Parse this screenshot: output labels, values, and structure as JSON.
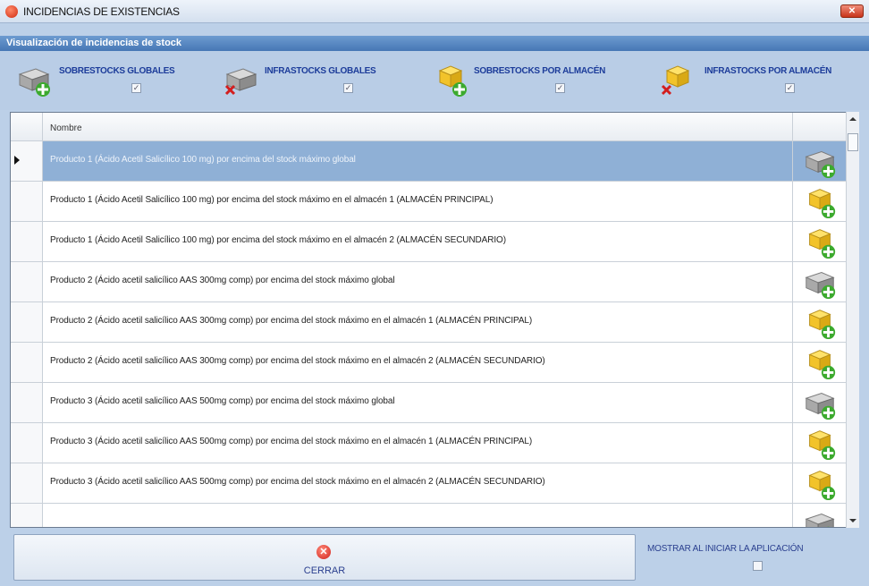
{
  "window": {
    "title": "INCIDENCIAS DE EXISTENCIAS",
    "close_label": "✕"
  },
  "section_header": "Visualización de incidencias de stock",
  "filters": [
    {
      "label": "SOBRESTOCKS GLOBALES",
      "checked": true,
      "icon": "gray-block-plus-icon"
    },
    {
      "label": "INFRASTOCKS GLOBALES",
      "checked": true,
      "icon": "gray-block-x-icon"
    },
    {
      "label": "SOBRESTOCKS POR ALMACÉN",
      "checked": true,
      "icon": "yellow-boxes-plus-icon"
    },
    {
      "label": "INFRASTOCKS POR ALMACÉN",
      "checked": true,
      "icon": "yellow-boxes-x-icon"
    }
  ],
  "grid": {
    "column_header": "Nombre",
    "rows": [
      {
        "text": "Producto 1 (Ácido Acetil Salicílico 100 mg) por encima del stock máximo global",
        "icon": "gray-block-plus-icon",
        "selected": true
      },
      {
        "text": "Producto 1 (Ácido Acetil Salicílico 100 mg) por encima del stock máximo en el almacén 1 (ALMACÉN PRINCIPAL)",
        "icon": "yellow-boxes-plus-icon",
        "selected": false
      },
      {
        "text": "Producto 1 (Ácido Acetil Salicílico 100 mg) por encima del stock máximo en el almacén 2 (ALMACÉN SECUNDARIO)",
        "icon": "yellow-boxes-plus-icon",
        "selected": false
      },
      {
        "text": "Producto 2 (Ácido acetil salicílico AAS 300mg comp) por encima del stock máximo global",
        "icon": "gray-block-plus-icon",
        "selected": false
      },
      {
        "text": "Producto 2 (Ácido acetil salicílico AAS 300mg comp) por encima del stock máximo en el almacén 1 (ALMACÉN PRINCIPAL)",
        "icon": "yellow-boxes-plus-icon",
        "selected": false
      },
      {
        "text": "Producto 2 (Ácido acetil salicílico AAS 300mg comp) por encima del stock máximo en el almacén 2 (ALMACÉN SECUNDARIO)",
        "icon": "yellow-boxes-plus-icon",
        "selected": false
      },
      {
        "text": "Producto 3 (Ácido acetil salicílico AAS 500mg comp) por encima del stock máximo global",
        "icon": "gray-block-plus-icon",
        "selected": false
      },
      {
        "text": "Producto 3 (Ácido acetil salicílico AAS 500mg comp) por encima del stock máximo en el almacén 1 (ALMACÉN PRINCIPAL)",
        "icon": "yellow-boxes-plus-icon",
        "selected": false
      },
      {
        "text": "Producto 3 (Ácido acetil salicílico AAS 500mg comp) por encima del stock máximo en el almacén 2 (ALMACÉN SECUNDARIO)",
        "icon": "yellow-boxes-plus-icon",
        "selected": false
      },
      {
        "text": "",
        "icon": "gray-block-plus-icon",
        "selected": false
      }
    ]
  },
  "footer": {
    "close_button_label": "CERRAR",
    "startup_label": "MOSTRAR AL INICIAR LA APLICACIÓN",
    "startup_checked": false
  },
  "colors": {
    "window_bg": "#bcd0e8",
    "header_bar": "#4677b5",
    "selected_row": "#8fb0d6",
    "label_blue": "#2a3f8f"
  }
}
